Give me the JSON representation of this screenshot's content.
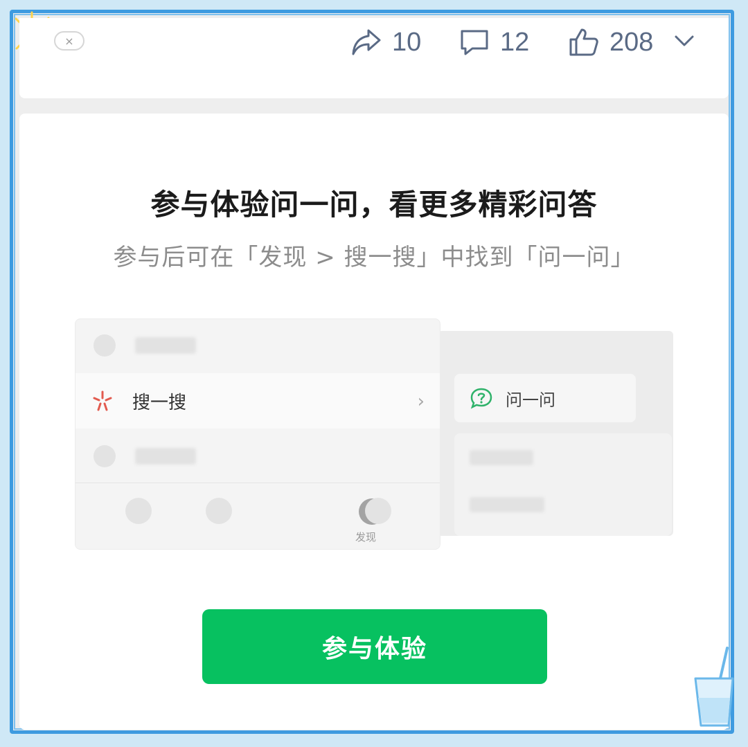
{
  "top_bar": {
    "close_glyph": "×",
    "share_count": "10",
    "comment_count": "12",
    "like_count": "208"
  },
  "main": {
    "headline": "参与体验问一问，看更多精彩问答",
    "subline": "参与后可在「发现 > 搜一搜」中找到「问一问」",
    "illustration": {
      "search_label": "搜一搜",
      "arrow_glyph": "›",
      "ask_label": "问一问",
      "discover_tab_label": "发现"
    },
    "cta_label": "参与体验"
  },
  "colors": {
    "frame": "#3e9be0",
    "accent_green": "#07c160",
    "action_gray": "#5a6a85"
  },
  "icons": [
    "share-icon",
    "comment-icon",
    "thumbs-up-icon",
    "chevron-down-icon",
    "search-sparkle-icon",
    "question-bubble-icon",
    "compass-icon",
    "sun-icon",
    "cup-icon"
  ]
}
